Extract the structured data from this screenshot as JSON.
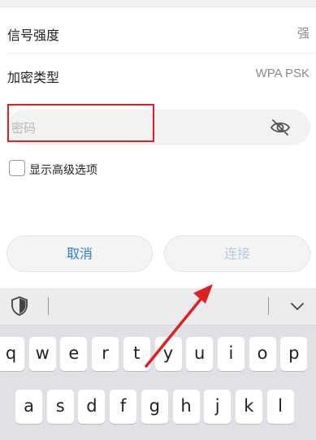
{
  "rows": [
    {
      "label": "信号强度",
      "value": "强"
    },
    {
      "label": "加密类型",
      "value": "WPA PSK"
    }
  ],
  "password": {
    "placeholder": "密码",
    "value": ""
  },
  "advanced": {
    "label": "显示高级选项",
    "checked": false
  },
  "buttons": {
    "cancel": "取消",
    "connect": "连接"
  },
  "keyboard": {
    "row1": [
      "q",
      "w",
      "e",
      "r",
      "t",
      "y",
      "u",
      "i",
      "o",
      "p"
    ],
    "row2": [
      "a",
      "s",
      "d",
      "f",
      "g",
      "h",
      "j",
      "k",
      "l"
    ]
  },
  "colors": {
    "accent": "#2a7fd4",
    "highlight": "#e02020",
    "disabled": "#b8cde3"
  },
  "icons": [
    "eye-slash-icon",
    "shield-icon",
    "chevron-down-icon",
    "red-arrow-annotation"
  ]
}
